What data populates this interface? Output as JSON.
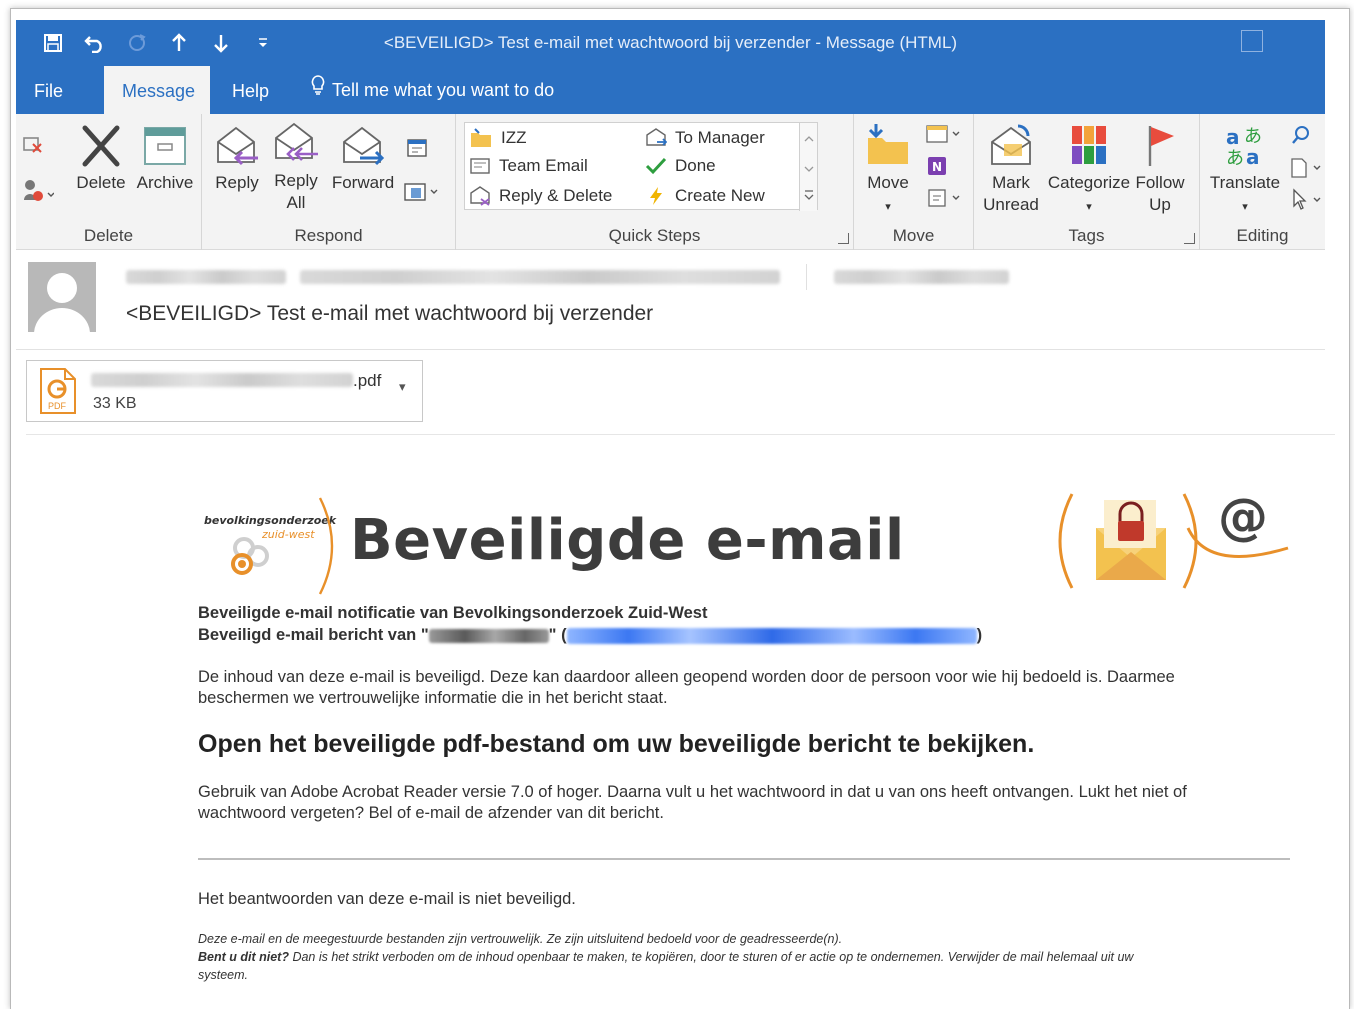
{
  "window": {
    "title": "<BEVEILIGD> Test e-mail met wachtwoord bij verzender  -  Message (HTML)"
  },
  "tabs": [
    {
      "label": "File"
    },
    {
      "label": "Message"
    },
    {
      "label": "Help"
    },
    {
      "label": "Tell me what you want to do"
    }
  ],
  "ribbon": {
    "delete": {
      "group": "Delete",
      "delete": "Delete",
      "archive": "Archive"
    },
    "respond": {
      "group": "Respond",
      "reply": "Reply",
      "reply_all_1": "Reply",
      "reply_all_2": "All",
      "forward": "Forward"
    },
    "quick_steps": {
      "group": "Quick Steps",
      "items": [
        "IZZ",
        "To Manager",
        "Team Email",
        "Done",
        "Reply & Delete",
        "Create New"
      ]
    },
    "move": {
      "group": "Move",
      "move": "Move"
    },
    "tags": {
      "group": "Tags",
      "mark_1": "Mark",
      "mark_2": "Unread",
      "categorize": "Categorize",
      "follow_1": "Follow",
      "follow_2": "Up"
    },
    "editing": {
      "group": "Editing",
      "translate": "Translate"
    }
  },
  "message": {
    "subject": "<BEVEILIGD> Test e-mail met wachtwoord bij verzender",
    "attachment": {
      "ext": ".pdf",
      "size": "33 KB",
      "icon_label": "PDF"
    }
  },
  "body": {
    "logo_line1": "bevolkingsonderzoek",
    "logo_line2": "zuid-west",
    "banner": "Beveiligde e-mail",
    "at": "@",
    "notif": "Beveiligde e-mail notificatie van Bevolkingsonderzoek Zuid-West",
    "from_prefix": "Beveiligd e-mail bericht van \"",
    "from_mid": "\" (",
    "from_suffix": ")",
    "para1_line1": "De inhoud van deze e-mail is beveiligd. Deze kan daardoor alleen geopend worden door de persoon voor wie hij bedoeld is. Daarmee",
    "para1_line2": "beschermen we vertrouwelijke informatie die in het bericht staat.",
    "heading": "Open het beveiligde pdf-bestand om uw beveiligde bericht te bekijken.",
    "para2_line1": "Gebruik van Adobe Acrobat Reader versie 7.0 of hoger. Daarna vult u het wachtwoord in dat u van ons heeft ontvangen. Lukt het niet of",
    "para2_line2": "wachtwoord vergeten? Bel of e-mail de afzender van dit bericht.",
    "reply_note": "Het beantwoorden van deze e-mail is niet beveiligd.",
    "disclaimer1": "Deze e-mail en de meegestuurde bestanden zijn vertrouwelijk. Ze zijn uitsluitend bedoeld voor de geadresseerde(n).",
    "disclaimer2_bold": "Bent u dit niet?",
    "disclaimer2_rest": " Dan is het strikt verboden om de inhoud openbaar te maken, te kopiëren, door te sturen of er actie op te ondernemen. Verwijder de mail helemaal uit uw",
    "disclaimer3": "systeem."
  },
  "colors": {
    "accent": "#2b70c2",
    "orange": "#e8902a",
    "flag": "#e84c3d"
  }
}
